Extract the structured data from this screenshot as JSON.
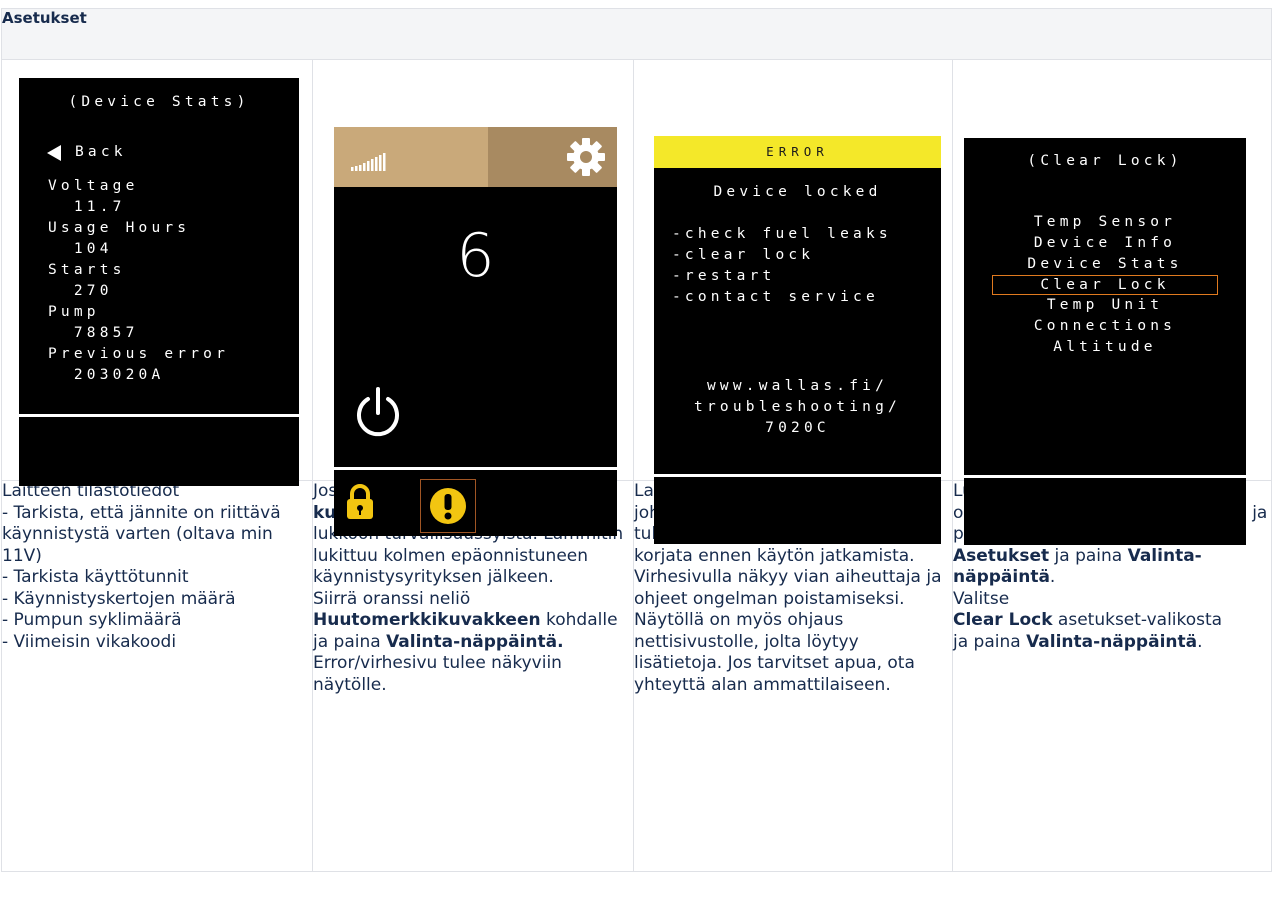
{
  "header": {
    "title": "Asetukset"
  },
  "screens": {
    "device_stats": {
      "title": "(Device Stats)",
      "back_label": "Back",
      "lines": [
        "Voltage",
        "  11.7",
        "Usage Hours",
        "  104",
        "Starts",
        "  270",
        "Pump",
        "  78857",
        "Previous error",
        "  203020A"
      ]
    },
    "main": {
      "number": "6"
    },
    "error": {
      "title": "ERROR",
      "subtitle": "Device locked",
      "items": [
        "-check fuel leaks",
        "-clear lock",
        "-restart",
        "-contact service"
      ],
      "url_lines": [
        "www.wallas.fi/",
        "troubleshooting/",
        "7020C"
      ]
    },
    "clear_lock": {
      "title": "(Clear Lock)",
      "menu": [
        "Temp Sensor",
        "Device Info",
        "Device Stats",
        "Clear Lock",
        "Temp Unit",
        "Connections",
        "Altitude"
      ],
      "selected_index": 3
    }
  },
  "columns": [
    {
      "runs": [
        {
          "text": "Laitteen tilastotiedot\n- Tarkista, että jännite on riittävä käynnistystä varten (oltava min 11V)\n- Tarkista käyttötunnit\n- Käynnistyskertojen määrä\n- Pumpun syklimäärä\n- Viimeisin vikakoodi",
          "bold": false
        }
      ]
    },
    {
      "runs": [
        {
          "text": "Jos tilariville tulee näkyviin ",
          "bold": false
        },
        {
          "text": "Lukon kuva",
          "bold": true
        },
        {
          "text": ", laite on mennyt\nlukkoon turvallisuussyistä. Lämmitin lukittuu kolmen epäonnistuneen käynnistysyrityksen jälkeen.\nSiirrä oranssi neliö ",
          "bold": false
        },
        {
          "text": "Huutomerkkikuvakkeen",
          "bold": true
        },
        {
          "text": " kohdalle ja paina ",
          "bold": false
        },
        {
          "text": "Valinta-näppäintä.",
          "bold": true
        },
        {
          "text": "\nError/virhesivu tulee näkyviin näytölle.",
          "bold": false
        }
      ]
    },
    {
      "runs": [
        {
          "text": "Laitteen lukkiutuminen saattaa johtua viasta. Lukituksen aiheuttaja tulisi selvittää ja mahdollinen vika\nkorjata ennen käytön jatkamista. Virhesivulla näkyy vian aiheuttaja ja ohjeet ongelman poistamiseksi. Näytöllä on myös ohjaus nettisivustolle, jolta löytyy lisätietoja. Jos tarvitset apua, ota yhteyttä alan ammattilaiseen.",
          "bold": false
        }
      ]
    },
    {
      "runs": [
        {
          "text": "Lukituksen poistamiseksi siirrä oranssi neliö ",
          "bold": false
        },
        {
          "text": "päävalikon",
          "bold": true
        },
        {
          "text": " kohdalle ja paina ",
          "bold": false
        },
        {
          "text": "Valinta-näppäintä",
          "bold": true
        },
        {
          "text": ". Valitse ",
          "bold": false
        },
        {
          "text": "Asetukset",
          "bold": true
        },
        {
          "text": " ja paina ",
          "bold": false
        },
        {
          "text": "Valinta-näppäintä",
          "bold": true
        },
        {
          "text": ".\nValitse\n",
          "bold": false
        },
        {
          "text": "Clear Lock",
          "bold": true
        },
        {
          "text": " asetukset-valikosta\nja paina ",
          "bold": false
        },
        {
          "text": "Valinta-näppäintä",
          "bold": true
        },
        {
          "text": ".",
          "bold": false
        }
      ]
    }
  ],
  "colors": {
    "header_bg": "#f4f5f7",
    "border": "#dfe1e6",
    "text": "#172b4d",
    "screen_bg": "#000000",
    "error_banner": "#f4e829",
    "status_left": "#c9a97a",
    "status_right": "#a88a61",
    "lock_yellow": "#f2c511",
    "selection_orange": "#e07a1f"
  },
  "icons": [
    "back-arrow-icon",
    "signal-bars-icon",
    "gear-icon",
    "power-icon",
    "lock-icon",
    "exclamation-icon"
  ]
}
